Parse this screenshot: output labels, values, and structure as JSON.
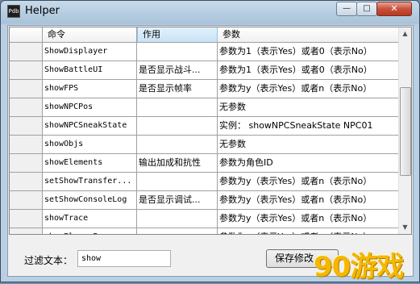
{
  "window": {
    "title": "Helper"
  },
  "caption_buttons": {
    "minimize": "—",
    "maximize": "□",
    "close": "✕"
  },
  "table": {
    "columns": [
      "命令",
      "作用",
      "参数"
    ],
    "rows": [
      {
        "cmd": "ShowDisplayer",
        "desc": "",
        "param": "参数为1（表示Yes）或者0（表示No）"
      },
      {
        "cmd": "ShowBattleUI",
        "desc": "是否显示战斗...",
        "param": "参数为1（表示Yes）或者0（表示No）"
      },
      {
        "cmd": "showFPS",
        "desc": "是否显示帧率",
        "param": "参数为y（表示Yes）或者n（表示No）"
      },
      {
        "cmd": "showNPCPos",
        "desc": "",
        "param": "无参数"
      },
      {
        "cmd": "showNPCSneakState",
        "desc": "",
        "param": "实例： showNPCSneakState NPC01"
      },
      {
        "cmd": "showObjs",
        "desc": "",
        "param": "无参数"
      },
      {
        "cmd": "showElements",
        "desc": "输出加成和抗性",
        "param": "参数为角色ID"
      },
      {
        "cmd": "setShowTransfer...",
        "desc": "",
        "param": "参数为y（表示Yes）或者n（表示No）"
      },
      {
        "cmd": "setShowConsoleLog",
        "desc": "是否显示调试...",
        "param": "参数为y（表示Yes）或者n（表示No）"
      },
      {
        "cmd": "showTrace",
        "desc": "",
        "param": "参数为y（表示Yes）或者n（表示No）"
      },
      {
        "cmd": "showPlayerPos",
        "desc": "",
        "param": "参数为y（表示Yes）或者n（表示No）"
      }
    ]
  },
  "filter": {
    "label": "过滤文本：",
    "value": "show"
  },
  "save_button": {
    "label": "保存修改"
  },
  "watermark": {
    "text": "90游戏"
  }
}
